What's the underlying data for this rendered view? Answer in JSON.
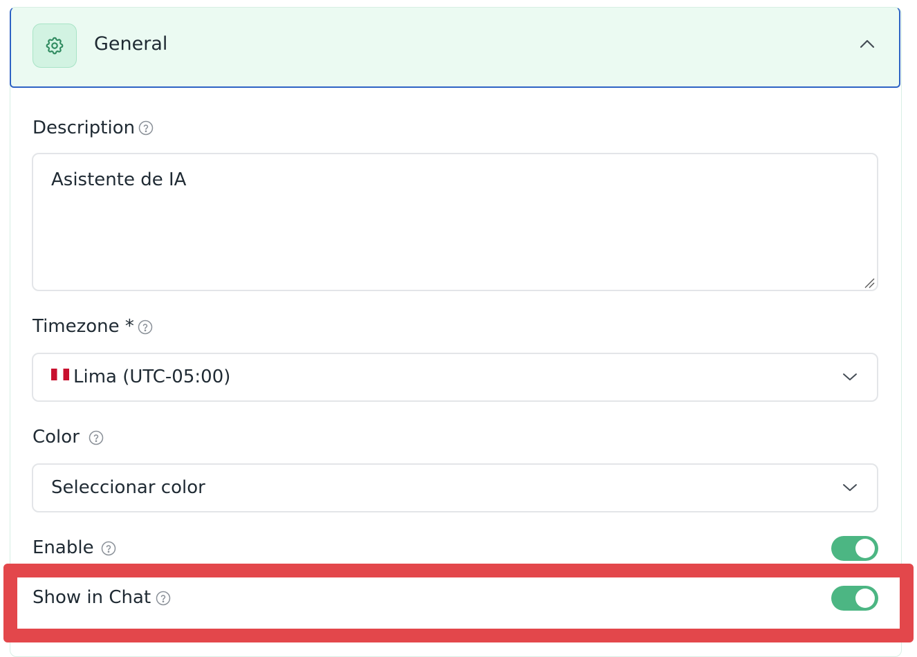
{
  "section": {
    "title": "General",
    "icon": "gear-icon",
    "collapse_icon": "chevron-up-icon"
  },
  "description": {
    "label": "Description",
    "value": "Asistente de IA"
  },
  "timezone": {
    "label": "Timezone *",
    "value": "Lima (UTC-05:00)",
    "flag": "peru-flag-icon"
  },
  "color": {
    "label": "Color",
    "value": "Seleccionar color"
  },
  "enable": {
    "label": "Enable",
    "on": true
  },
  "show_in_chat": {
    "label": "Show in Chat",
    "on": true
  },
  "colors": {
    "accent": "#4cb683",
    "header_bg": "#ebfaf2",
    "focus_border": "#2d62c4",
    "highlight": "#e3474b"
  }
}
